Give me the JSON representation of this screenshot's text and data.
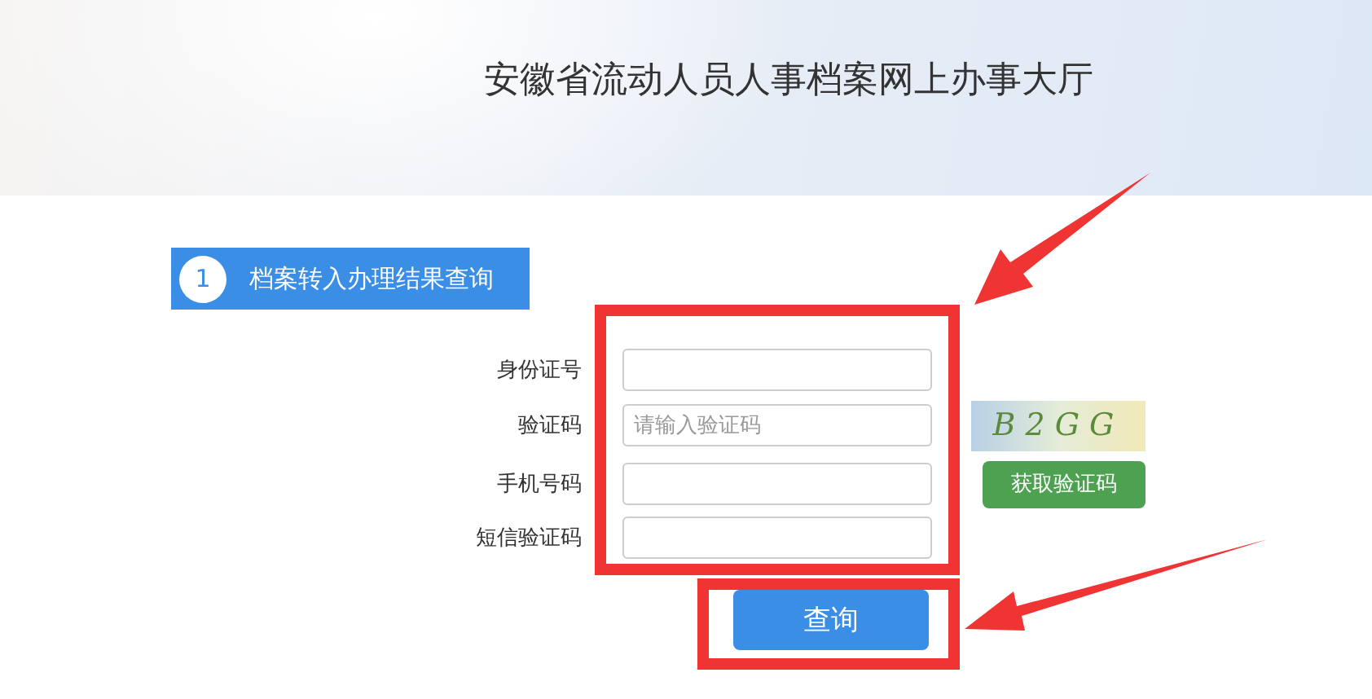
{
  "header": {
    "title": "安徽省流动人员人事档案网上办事大厅"
  },
  "section": {
    "step": "1",
    "title": "档案转入办理结果查询"
  },
  "form": {
    "fields": [
      {
        "label": "身份证号",
        "kind": "text"
      },
      {
        "label": "验证码",
        "placeholder": "请输入验证码",
        "kind": "captcha",
        "captcha": "B2GG"
      },
      {
        "label": "手机号码",
        "kind": "sms",
        "button": "获取验证码"
      },
      {
        "label": "短信验证码",
        "kind": "text"
      }
    ],
    "submit": "查询"
  }
}
